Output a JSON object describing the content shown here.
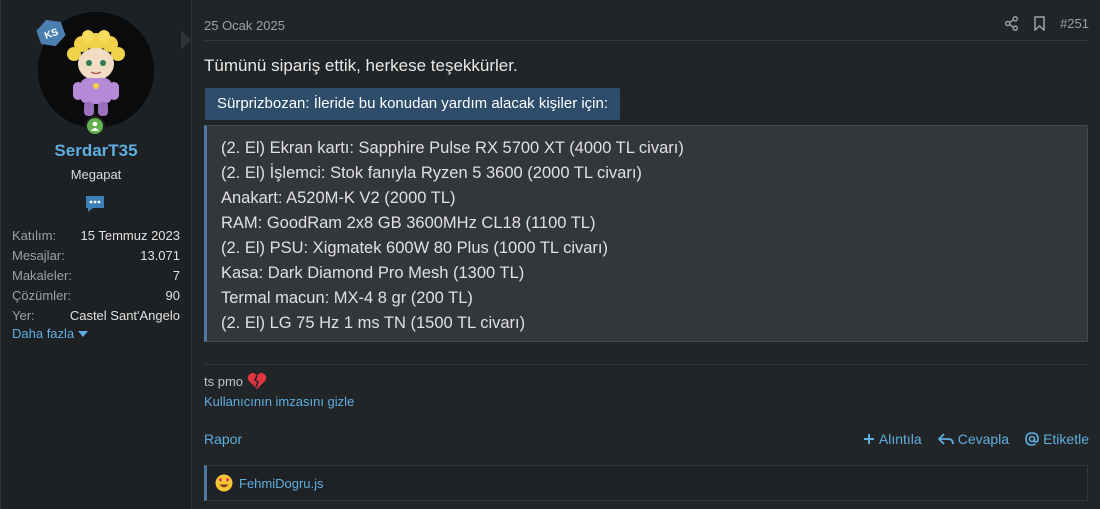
{
  "user": {
    "badge": "KS",
    "username": "SerdarT35",
    "title": "Megapat",
    "stats": [
      {
        "label": "Katılım:",
        "value": "15 Temmuz 2023"
      },
      {
        "label": "Mesajlar:",
        "value": "13.071"
      },
      {
        "label": "Makaleler:",
        "value": "7"
      },
      {
        "label": "Çözümler:",
        "value": "90"
      },
      {
        "label": "Yer:",
        "value": "Castel Sant'Angelo"
      }
    ],
    "more_label": "Daha fazla"
  },
  "post": {
    "date": "25 Ocak 2025",
    "number": "#251",
    "message": "Tümünü sipariş ettik, herkese teşekkürler.",
    "spoiler_label": "Sürprizbozan: İleride bu konudan yardım alacak kişiler için:",
    "spoiler_lines": [
      "(2. El) Ekran kartı: Sapphire Pulse RX 5700 XT (4000 TL civarı)",
      "(2. El) İşlemci: Stok fanıyla Ryzen 5 3600 (2000 TL civarı)",
      "Anakart: A520M-K V2 (2000 TL)",
      "RAM: GoodRam 2x8 GB 3600MHz CL18 (1100 TL)",
      "(2. El) PSU: Xigmatek 600W 80 Plus (1000 TL civarı)",
      "Kasa: Dark Diamond Pro Mesh (1300 TL)",
      "Termal macun: MX-4 8 gr (200 TL)",
      "(2. El) LG 75 Hz 1 ms TN (1500 TL civarı)"
    ],
    "signature": "ts pmo",
    "hide_signature": "Kullanıcının imzasını gizle",
    "report": "Rapor",
    "quote": "Alıntıla",
    "reply": "Cevapla",
    "tag": "Etiketle",
    "reaction_user": "FehmiDogru.js"
  },
  "colors": {
    "accent": "#5eaee0",
    "spoiler_bg": "#2d4d6a",
    "online": "#63b24e"
  }
}
